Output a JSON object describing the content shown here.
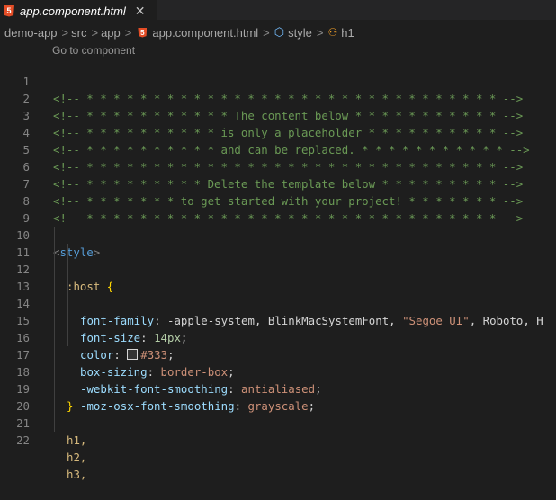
{
  "tab": {
    "title": "app.component.html",
    "close": "✕"
  },
  "breadcrumb": {
    "items": [
      "demo-app",
      "src",
      "app",
      "app.component.html",
      "style",
      "h1"
    ],
    "separator": ">"
  },
  "codelens": "Go to component",
  "line_numbers": [
    "1",
    "2",
    "3",
    "4",
    "5",
    "6",
    "7",
    "8",
    "9",
    "10",
    "11",
    "12",
    "13",
    "14",
    "15",
    "16",
    "17",
    "18",
    "19",
    "20",
    "21",
    "22"
  ],
  "code": {
    "l1": "<!-- * * * * * * * * * * * * * * * * * * * * * * * * * * * * * * * -->",
    "l2": "<!-- * * * * * * * * * * * The content below * * * * * * * * * * * -->",
    "l3": "<!-- * * * * * * * * * * is only a placeholder * * * * * * * * * * -->",
    "l4": "<!-- * * * * * * * * * * and can be replaced. * * * * * * * * * * * -->",
    "l5": "<!-- * * * * * * * * * * * * * * * * * * * * * * * * * * * * * * * -->",
    "l6": "<!-- * * * * * * * * * Delete the template below * * * * * * * * * -->",
    "l7": "<!-- * * * * * * * to get started with your project! * * * * * * * -->",
    "l8": "<!-- * * * * * * * * * * * * * * * * * * * * * * * * * * * * * * * -->",
    "l10_open": "<",
    "l10_tag": "style",
    "l10_close": ">",
    "l11_sel": ":host",
    "l11_brace": " {",
    "l12_prop": "font-family",
    "l12_colon": ": ",
    "l12_v1": "-apple-system, BlinkMacSystemFont, ",
    "l12_str": "\"Segoe UI\"",
    "l12_v2": ", Roboto, H",
    "l13_prop": "font-size",
    "l13_colon": ": ",
    "l13_num": "14px",
    "l13_semi": ";",
    "l14_prop": "color",
    "l14_colon": ": ",
    "l14_val": "#333",
    "l14_semi": ";",
    "l15_prop": "box-sizing",
    "l15_colon": ": ",
    "l15_val": "border-box",
    "l15_semi": ";",
    "l16_prop": "-webkit-font-smoothing",
    "l16_colon": ": ",
    "l16_val": "antialiased",
    "l16_semi": ";",
    "l17_prop": "-moz-osx-font-smoothing",
    "l17_colon": ": ",
    "l17_val": "grayscale",
    "l17_semi": ";",
    "l18_brace": "}",
    "l20": "h1,",
    "l21": "h2,",
    "l22": "h3,"
  },
  "colors": {
    "background": "#1e1e1e",
    "comment": "#6a9955",
    "tag": "#569cd6",
    "property": "#9cdcfe",
    "value": "#ce9178",
    "number": "#b5cea8",
    "selector": "#d7ba7d",
    "swatch": "#333333"
  },
  "icons": {
    "tab": "html5-icon",
    "close": "close-icon",
    "breadcrumb_file": "html5-icon",
    "style": "symbol-class-icon",
    "h1": "symbol-element-icon"
  }
}
